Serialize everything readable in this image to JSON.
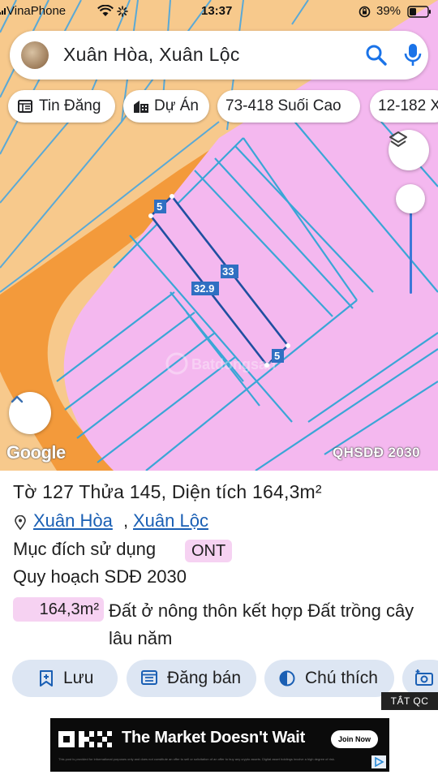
{
  "status_bar": {
    "carrier": "VinaPhone",
    "time": "13:37",
    "battery": "39%"
  },
  "search": {
    "query": "Xuân Hòa, Xuân Lộc"
  },
  "chips": [
    {
      "label": "Tin Đăng",
      "icon": "news-icon"
    },
    {
      "label": "Dự Án",
      "icon": "buildings-icon"
    },
    {
      "label": "73-418 Suối Cao",
      "icon": ""
    },
    {
      "label": "12-182 X",
      "icon": ""
    }
  ],
  "map": {
    "edge_labels": [
      "5",
      "33",
      "32.9",
      "5"
    ],
    "watermark": "Batdongsan",
    "google_logo": "Google",
    "badge": "QHSDĐ 2030",
    "colors": {
      "residential": "#f4b8ef",
      "road": "#f39a3b",
      "agriculture": "#f7c98c",
      "parcel_line": "#3aa6d6",
      "selected_parcel": "#1f4fa0"
    }
  },
  "sheet": {
    "title": "Tờ 127 Thửa 145, Diện tích 164,3m²",
    "location": {
      "commune": "Xuân Hòa",
      "separator": ",",
      "district": "Xuân Lộc"
    },
    "purpose_label": "Mục đích sử dụng",
    "purpose_code": "ONT",
    "plan_label": "Quy hoạch SDĐ 2030",
    "area": "164,3m²",
    "land_type": "Đất ở nông thôn kết hợp Đất trồng cây lâu năm",
    "actions": [
      {
        "label": "Lưu",
        "icon": "bookmark-plus-icon"
      },
      {
        "label": "Đăng bán",
        "icon": "listing-icon"
      },
      {
        "label": "Chú thích",
        "icon": "contrast-icon"
      }
    ],
    "ad_tag": "TẮT QC"
  },
  "ad": {
    "brand": "OKX",
    "headline": "The Market Doesn't Wait",
    "cta": "Join Now",
    "fine_print": "This post is provided for informational purposes only and does not constitute an offer to sell or solicitation of an offer to buy any crypto assets. Digital asset holdings involve a high degree of risk."
  }
}
